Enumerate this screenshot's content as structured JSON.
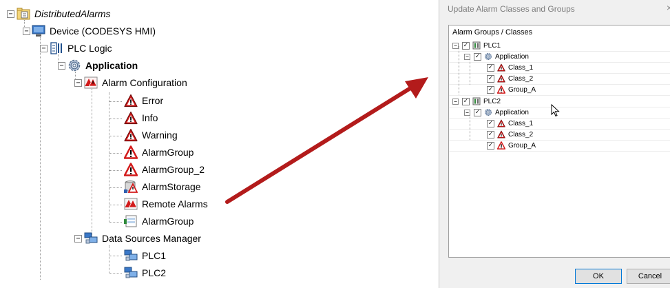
{
  "tree": {
    "root": "DistributedAlarms",
    "device": "Device (CODESYS HMI)",
    "plc_logic": "PLC Logic",
    "application": "Application",
    "alarm_configuration": "Alarm Configuration",
    "alarm_items": [
      "Error",
      "Info",
      "Warning",
      "AlarmGroup",
      "AlarmGroup_2",
      "AlarmStorage",
      "Remote Alarms",
      "AlarmGroup"
    ],
    "data_sources_manager": "Data Sources Manager",
    "data_sources": [
      "PLC1",
      "PLC2"
    ]
  },
  "dialog": {
    "title": "Update Alarm Classes and Groups",
    "close": "×",
    "header": "Alarm Groups / Classes",
    "plc1": {
      "label": "PLC1",
      "application": "Application",
      "items": [
        "Class_1",
        "Class_2",
        "Group_A"
      ]
    },
    "plc2": {
      "label": "PLC2",
      "application": "Application",
      "items": [
        "Class_1",
        "Class_2",
        "Group_A"
      ]
    },
    "ok": "OK",
    "cancel": "Cancel"
  },
  "colors": {
    "arrow": "#b31b1b",
    "alarm_red": "#d21a1a",
    "checkbox_border": "#7a7a7a"
  }
}
